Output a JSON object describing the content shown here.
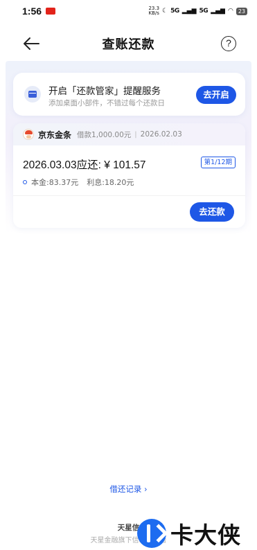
{
  "status_bar": {
    "time": "1:56",
    "net_speed": "23.3\nKB/s",
    "signal1": "5G",
    "signal2": "5G",
    "battery": "23"
  },
  "header": {
    "title": "查账还款",
    "help": "?"
  },
  "reminder": {
    "title": "开启「还款管家」提醒服务",
    "subtitle": "添加桌面小部件，不错过每个还款日",
    "button": "去开启"
  },
  "loan": {
    "brand": "京东金条",
    "amount": "借款1,000.00元",
    "separator": "|",
    "date": "2026.02.03",
    "due_text": "2026.03.03应还: ¥ 101.57",
    "period": "第1/12期",
    "principal": "本金:83.37元",
    "interest": "利息:18.20元",
    "button": "去还款"
  },
  "footer": {
    "records_link": "借还记录 ›",
    "title": "天星信",
    "subtitle": "天星金融旗下信…务平台"
  },
  "watermark": {
    "text": "卡大侠"
  },
  "colors": {
    "accent": "#1e57e6",
    "background_band": "#eef2fb"
  }
}
